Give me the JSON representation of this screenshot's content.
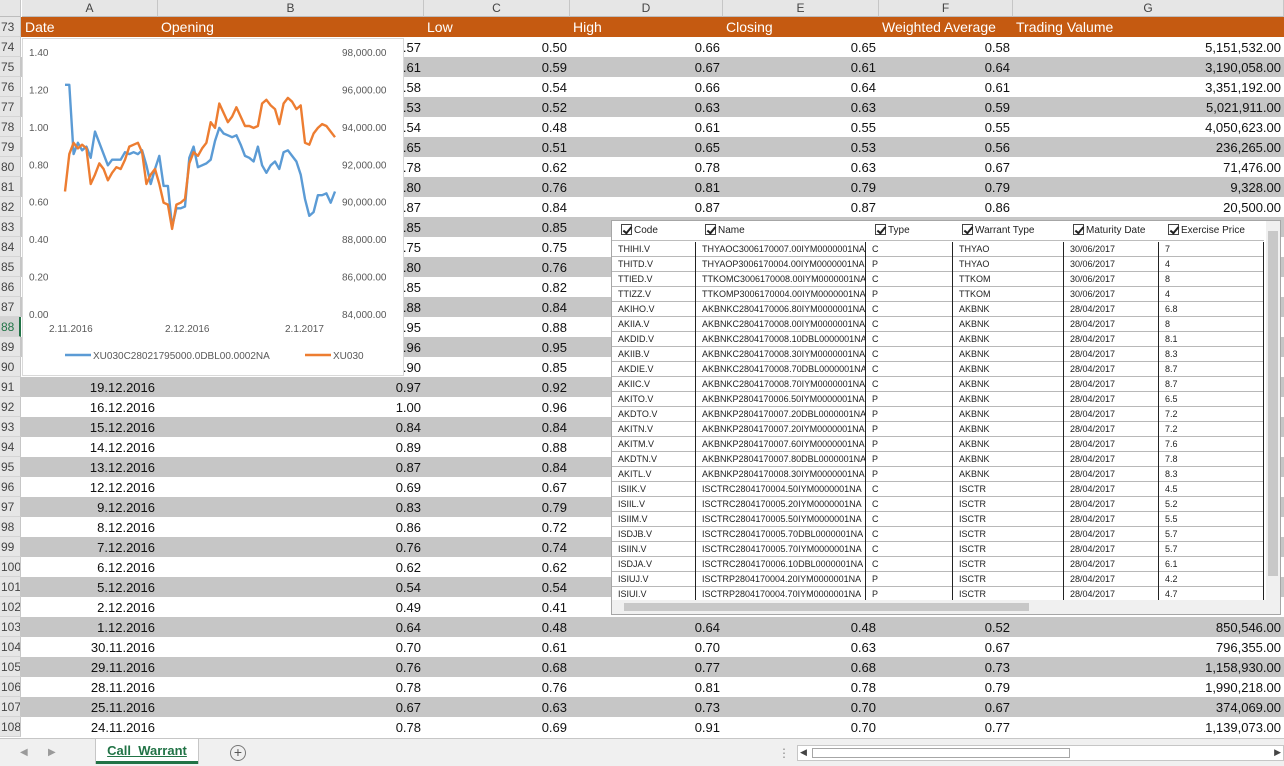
{
  "sheet": {
    "column_letters": [
      "A",
      "B",
      "C",
      "D",
      "E",
      "F",
      "G"
    ],
    "header_row": {
      "row_number": "73",
      "labels": [
        "Date",
        "Opening",
        "Low",
        "High",
        "Closing",
        "Weighted Average",
        "Trading Valume"
      ]
    },
    "selected_row": "88",
    "rows": [
      {
        "n": "74",
        "a": "",
        "b": ".57",
        "c": "0.50",
        "d": "0.66",
        "e": "0.65",
        "f": "0.58",
        "g": "5,151,532.00"
      },
      {
        "n": "75",
        "a": "",
        "b": ".61",
        "c": "0.59",
        "d": "0.67",
        "e": "0.61",
        "f": "0.64",
        "g": "3,190,058.00"
      },
      {
        "n": "76",
        "a": "",
        "b": ".58",
        "c": "0.54",
        "d": "0.66",
        "e": "0.64",
        "f": "0.61",
        "g": "3,351,192.00"
      },
      {
        "n": "77",
        "a": "",
        "b": ".53",
        "c": "0.52",
        "d": "0.63",
        "e": "0.63",
        "f": "0.59",
        "g": "5,021,911.00"
      },
      {
        "n": "78",
        "a": "",
        "b": ".54",
        "c": "0.48",
        "d": "0.61",
        "e": "0.55",
        "f": "0.55",
        "g": "4,050,623.00"
      },
      {
        "n": "79",
        "a": "",
        "b": ".65",
        "c": "0.51",
        "d": "0.65",
        "e": "0.53",
        "f": "0.56",
        "g": "236,265.00"
      },
      {
        "n": "80",
        "a": "",
        "b": ".78",
        "c": "0.62",
        "d": "0.78",
        "e": "0.63",
        "f": "0.67",
        "g": "71,476.00"
      },
      {
        "n": "81",
        "a": "",
        "b": ".80",
        "c": "0.76",
        "d": "0.81",
        "e": "0.79",
        "f": "0.79",
        "g": "9,328.00"
      },
      {
        "n": "82",
        "a": "",
        "b": ".87",
        "c": "0.84",
        "d": "0.87",
        "e": "0.87",
        "f": "0.86",
        "g": "20,500.00"
      },
      {
        "n": "83",
        "a": "",
        "b": ".85",
        "c": "0.85",
        "d": "",
        "e": "",
        "f": "",
        "g": ""
      },
      {
        "n": "84",
        "a": "",
        "b": ".75",
        "c": "0.75",
        "d": "",
        "e": "",
        "f": "",
        "g": ""
      },
      {
        "n": "85",
        "a": "",
        "b": ".80",
        "c": "0.76",
        "d": "",
        "e": "",
        "f": "",
        "g": ""
      },
      {
        "n": "86",
        "a": "",
        "b": ".85",
        "c": "0.82",
        "d": "",
        "e": "",
        "f": "",
        "g": ""
      },
      {
        "n": "87",
        "a": "",
        "b": ".88",
        "c": "0.84",
        "d": "",
        "e": "",
        "f": "",
        "g": ""
      },
      {
        "n": "88",
        "a": "",
        "b": ".95",
        "c": "0.88",
        "d": "",
        "e": "",
        "f": "",
        "g": ""
      },
      {
        "n": "89",
        "a": "",
        "b": ".96",
        "c": "0.95",
        "d": "",
        "e": "",
        "f": "",
        "g": ""
      },
      {
        "n": "90",
        "a": "",
        "b": ".90",
        "c": "0.85",
        "d": "",
        "e": "",
        "f": "",
        "g": ""
      },
      {
        "n": "91",
        "a": "19.12.2016",
        "b": "0.97",
        "c": "0.92",
        "d": "",
        "e": "",
        "f": "",
        "g": ""
      },
      {
        "n": "92",
        "a": "16.12.2016",
        "b": "1.00",
        "c": "0.96",
        "d": "",
        "e": "",
        "f": "",
        "g": ""
      },
      {
        "n": "93",
        "a": "15.12.2016",
        "b": "0.84",
        "c": "0.84",
        "d": "",
        "e": "",
        "f": "",
        "g": ""
      },
      {
        "n": "94",
        "a": "14.12.2016",
        "b": "0.89",
        "c": "0.88",
        "d": "",
        "e": "",
        "f": "",
        "g": ""
      },
      {
        "n": "95",
        "a": "13.12.2016",
        "b": "0.87",
        "c": "0.84",
        "d": "",
        "e": "",
        "f": "",
        "g": ""
      },
      {
        "n": "96",
        "a": "12.12.2016",
        "b": "0.69",
        "c": "0.67",
        "d": "",
        "e": "",
        "f": "",
        "g": ""
      },
      {
        "n": "97",
        "a": "9.12.2016",
        "b": "0.83",
        "c": "0.79",
        "d": "",
        "e": "",
        "f": "",
        "g": ""
      },
      {
        "n": "98",
        "a": "8.12.2016",
        "b": "0.86",
        "c": "0.72",
        "d": "",
        "e": "",
        "f": "",
        "g": ""
      },
      {
        "n": "99",
        "a": "7.12.2016",
        "b": "0.76",
        "c": "0.74",
        "d": "",
        "e": "",
        "f": "",
        "g": ""
      },
      {
        "n": "100",
        "a": "6.12.2016",
        "b": "0.62",
        "c": "0.62",
        "d": "",
        "e": "",
        "f": "",
        "g": ""
      },
      {
        "n": "101",
        "a": "5.12.2016",
        "b": "0.54",
        "c": "0.54",
        "d": "",
        "e": "",
        "f": "",
        "g": ""
      },
      {
        "n": "102",
        "a": "2.12.2016",
        "b": "0.49",
        "c": "0.41",
        "d": "",
        "e": "",
        "f": "",
        "g": ""
      },
      {
        "n": "103",
        "a": "1.12.2016",
        "b": "0.64",
        "c": "0.48",
        "d": "0.64",
        "e": "0.48",
        "f": "0.52",
        "g": "850,546.00"
      },
      {
        "n": "104",
        "a": "30.11.2016",
        "b": "0.70",
        "c": "0.61",
        "d": "0.70",
        "e": "0.63",
        "f": "0.67",
        "g": "796,355.00"
      },
      {
        "n": "105",
        "a": "29.11.2016",
        "b": "0.76",
        "c": "0.68",
        "d": "0.77",
        "e": "0.68",
        "f": "0.73",
        "g": "1,158,930.00"
      },
      {
        "n": "106",
        "a": "28.11.2016",
        "b": "0.78",
        "c": "0.76",
        "d": "0.81",
        "e": "0.78",
        "f": "0.79",
        "g": "1,990,218.00"
      },
      {
        "n": "107",
        "a": "25.11.2016",
        "b": "0.67",
        "c": "0.63",
        "d": "0.73",
        "e": "0.70",
        "f": "0.67",
        "g": "374,069.00"
      },
      {
        "n": "108",
        "a": "24.11.2016",
        "b": "0.78",
        "c": "0.69",
        "d": "0.91",
        "e": "0.70",
        "f": "0.77",
        "g": "1,139,073.00"
      }
    ]
  },
  "chart_data": {
    "type": "line",
    "title": "",
    "xlabel": "",
    "ylabel": "",
    "x_tick_labels": [
      "2.11.2016",
      "2.12.2016",
      "2.1.2017"
    ],
    "y_left_tick_labels": [
      "0.00",
      "0.20",
      "0.40",
      "0.60",
      "0.80",
      "1.00",
      "1.20",
      "1.40"
    ],
    "y_right_tick_labels": [
      "84,000.00",
      "86,000.00",
      "88,000.00",
      "90,000.00",
      "92,000.00",
      "94,000.00",
      "96,000.00",
      "98,000.00"
    ],
    "ylim_left": [
      0,
      1.4
    ],
    "ylim_right": [
      84000,
      98000
    ],
    "legend_position": "bottom",
    "grid": false,
    "series": [
      {
        "name": "XU030C28021795000.0DBL00.0002NA",
        "axis": "left",
        "color": "#5b9bd5",
        "values": [
          1.23,
          1.23,
          0.86,
          0.92,
          0.88,
          0.9,
          0.84,
          0.98,
          0.92,
          0.86,
          0.8,
          0.83,
          0.83,
          0.83,
          0.87,
          0.86,
          0.87,
          0.86,
          0.88,
          0.8,
          0.7,
          0.78,
          0.85,
          0.69,
          0.69,
          0.47,
          0.57,
          0.57,
          0.58,
          0.84,
          0.9,
          0.79,
          0.8,
          0.81,
          0.83,
          0.93,
          1.0,
          0.97,
          0.96,
          0.95,
          0.96,
          0.91,
          0.85,
          0.84,
          0.82,
          0.9,
          0.8,
          0.76,
          0.8,
          0.82,
          0.78,
          0.87,
          0.88,
          0.85,
          0.82,
          0.75,
          0.62,
          0.53,
          0.55,
          0.64,
          0.64,
          0.65,
          0.6,
          0.66
        ]
      },
      {
        "name": "XU030",
        "axis": "right",
        "color": "#ed7d31",
        "values": [
          90.6,
          92.6,
          93.2,
          92.9,
          93.1,
          92.9,
          91.0,
          91.5,
          92.1,
          91.8,
          91.2,
          91.6,
          91.9,
          91.8,
          92.3,
          93.0,
          93.1,
          93.2,
          92.7,
          91.0,
          91.5,
          91.8,
          91.0,
          90.0,
          89.9,
          88.6,
          89.9,
          90.0,
          90.2,
          92.1,
          92.7,
          92.5,
          92.9,
          93.2,
          94.3,
          94.0,
          95.3,
          94.8,
          94.3,
          94.6,
          95.1,
          94.6,
          94.1,
          94.1,
          94.0,
          94.1,
          95.3,
          95.5,
          95.2,
          95.0,
          94.2,
          95.3,
          95.6,
          95.4,
          95.0,
          95.2,
          93.2,
          93.1,
          93.7,
          94.0,
          94.2,
          94.1,
          93.8,
          93.5
        ]
      }
    ]
  },
  "warrant_table": {
    "columns": [
      "Code",
      "Name",
      "Type",
      "Warrant Type",
      "Maturity Date",
      "Exercise Price"
    ],
    "rows": [
      [
        "THIHI.V",
        "THYAOC3006170007.00IYM0000001NA",
        "C",
        "THYAO",
        "30/06/2017",
        "7"
      ],
      [
        "THITD.V",
        "THYAOP3006170004.00IYM0000001NA",
        "P",
        "THYAO",
        "30/06/2017",
        "4"
      ],
      [
        "TTIED.V",
        "TTKOMC3006170008.00IYM0000001NA",
        "C",
        "TTKOM",
        "30/06/2017",
        "8"
      ],
      [
        "TTIZZ.V",
        "TTKOMP3006170004.00IYM0000001NA",
        "P",
        "TTKOM",
        "30/06/2017",
        "4"
      ],
      [
        "AKIHO.V",
        "AKBNKC2804170006.80IYM0000001NA",
        "C",
        "AKBNK",
        "28/04/2017",
        "6.8"
      ],
      [
        "AKIIA.V",
        "AKBNKC2804170008.00IYM0000001NA",
        "C",
        "AKBNK",
        "28/04/2017",
        "8"
      ],
      [
        "AKDID.V",
        "AKBNKC2804170008.10DBL0000001NA",
        "C",
        "AKBNK",
        "28/04/2017",
        "8.1"
      ],
      [
        "AKIIB.V",
        "AKBNKC2804170008.30IYM0000001NA",
        "C",
        "AKBNK",
        "28/04/2017",
        "8.3"
      ],
      [
        "AKDIE.V",
        "AKBNKC2804170008.70DBL0000001NA",
        "C",
        "AKBNK",
        "28/04/2017",
        "8.7"
      ],
      [
        "AKIIC.V",
        "AKBNKC2804170008.70IYM0000001NA",
        "C",
        "AKBNK",
        "28/04/2017",
        "8.7"
      ],
      [
        "AKITO.V",
        "AKBNKP2804170006.50IYM0000001NA",
        "P",
        "AKBNK",
        "28/04/2017",
        "6.5"
      ],
      [
        "AKDTO.V",
        "AKBNKP2804170007.20DBL0000001NA",
        "P",
        "AKBNK",
        "28/04/2017",
        "7.2"
      ],
      [
        "AKITN.V",
        "AKBNKP2804170007.20IYM0000001NA",
        "P",
        "AKBNK",
        "28/04/2017",
        "7.2"
      ],
      [
        "AKITM.V",
        "AKBNKP2804170007.60IYM0000001NA",
        "P",
        "AKBNK",
        "28/04/2017",
        "7.6"
      ],
      [
        "AKDTN.V",
        "AKBNKP2804170007.80DBL0000001NA",
        "P",
        "AKBNK",
        "28/04/2017",
        "7.8"
      ],
      [
        "AKITL.V",
        "AKBNKP2804170008.30IYM0000001NA",
        "P",
        "AKBNK",
        "28/04/2017",
        "8.3"
      ],
      [
        "ISIIK.V",
        "ISCTRC2804170004.50IYM0000001NA",
        "C",
        "ISCTR",
        "28/04/2017",
        "4.5"
      ],
      [
        "ISIIL.V",
        "ISCTRC2804170005.20IYM0000001NA",
        "C",
        "ISCTR",
        "28/04/2017",
        "5.2"
      ],
      [
        "ISIIM.V",
        "ISCTRC2804170005.50IYM0000001NA",
        "C",
        "ISCTR",
        "28/04/2017",
        "5.5"
      ],
      [
        "ISDJB.V",
        "ISCTRC2804170005.70DBL0000001NA",
        "C",
        "ISCTR",
        "28/04/2017",
        "5.7"
      ],
      [
        "ISIIN.V",
        "ISCTRC2804170005.70IYM0000001NA",
        "C",
        "ISCTR",
        "28/04/2017",
        "5.7"
      ],
      [
        "ISDJA.V",
        "ISCTRC2804170006.10DBL0000001NA",
        "C",
        "ISCTR",
        "28/04/2017",
        "6.1"
      ],
      [
        "ISIUJ.V",
        "ISCTRP2804170004.20IYM0000001NA",
        "P",
        "ISCTR",
        "28/04/2017",
        "4.2"
      ],
      [
        "ISIUI.V",
        "ISCTRP2804170004.70IYM0000001NA",
        "P",
        "ISCTR",
        "28/04/2017",
        "4.7"
      ]
    ]
  },
  "tabbar": {
    "sheet_tab": "Call_Warrant",
    "add_symbol": "+",
    "split_dots": "⋮",
    "scroll_left": "◀",
    "scroll_right": "▶",
    "nav_prev": "◀",
    "nav_next": "▶"
  },
  "colors": {
    "header_fill": "#c55a11",
    "band_fill": "#c6c6c6",
    "accent": "#217346"
  }
}
